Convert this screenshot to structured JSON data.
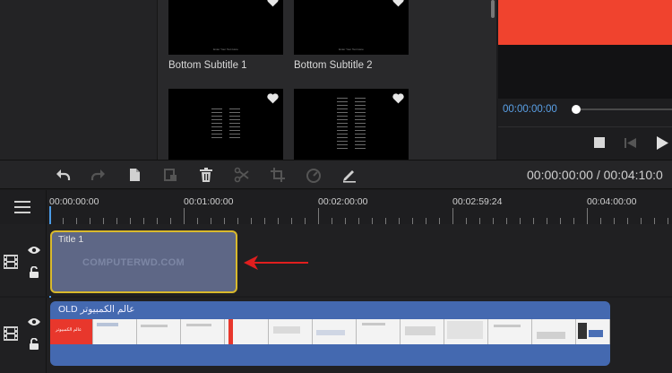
{
  "media": {
    "items": [
      {
        "label": "Bottom Subtitle 1",
        "caption": "Enter Your Text Here"
      },
      {
        "label": "Bottom Subtitle 2",
        "caption": "Enter Your Text Here"
      },
      {
        "label": "",
        "caption": ""
      },
      {
        "label": "",
        "caption": ""
      }
    ]
  },
  "preview": {
    "current_time": "00:00:00:00",
    "colors": {
      "frame": "#f0432e",
      "time": "#5aa0e6"
    }
  },
  "toolbar": {
    "timecode": "00:00:00:00 / 00:04:10:0",
    "icons": [
      "undo-icon",
      "redo-icon",
      "copy-icon",
      "duplicate-icon",
      "delete-icon",
      "split-icon",
      "crop-icon",
      "speed-icon",
      "edit-pen-icon"
    ]
  },
  "ruler": {
    "ticks": [
      "00:00:00:00",
      "00:01:00:00",
      "00:02:00:00",
      "00:02:59:24",
      "00:04:00:00"
    ]
  },
  "tracks": {
    "title_clip": {
      "name": "Title 1",
      "watermark": "COMPUTERWD.COM"
    },
    "video_clip": {
      "name": "OLD عالم الكمبيوتر",
      "first_frame_text": "عالم الكمبيوتر"
    }
  },
  "colors": {
    "playhead": "#4b9be6",
    "selection_border": "#d9b92c",
    "arrow": "#e01e1e"
  }
}
